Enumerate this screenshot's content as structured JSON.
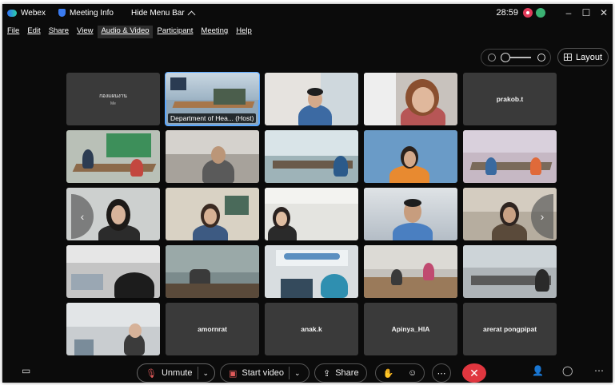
{
  "titlebar": {
    "app_name": "Webex",
    "meeting_info": "Meeting Info",
    "hide_menu_bar": "Hide Menu Bar",
    "timer": "28:59",
    "minimize": "–",
    "maximize": "☐",
    "close": "✕"
  },
  "menu": {
    "items": [
      "File",
      "Edit",
      "Share",
      "View",
      "Audio & Video",
      "Participant",
      "Meeting",
      "Help"
    ],
    "active": "Audio & Video"
  },
  "view": {
    "layout_label": "Layout"
  },
  "tiles": {
    "me_name": "กองแผนงาน",
    "me_sub": "Me",
    "host_label": "Department of Hea... (Host)",
    "prakob": "prakob.t",
    "amornrat": "amornrat",
    "anak": "anak.k",
    "apinya": "Apinya_HIA",
    "arerat": "arerat pongpipat"
  },
  "toolbar": {
    "unmute": "Unmute",
    "start_video": "Start video",
    "share": "Share"
  },
  "colors": {
    "window_bg": "#0b0b0b",
    "tile_bg": "#3a3a3a",
    "end_call": "#e0363f",
    "host_outline": "#5aa7ff"
  }
}
